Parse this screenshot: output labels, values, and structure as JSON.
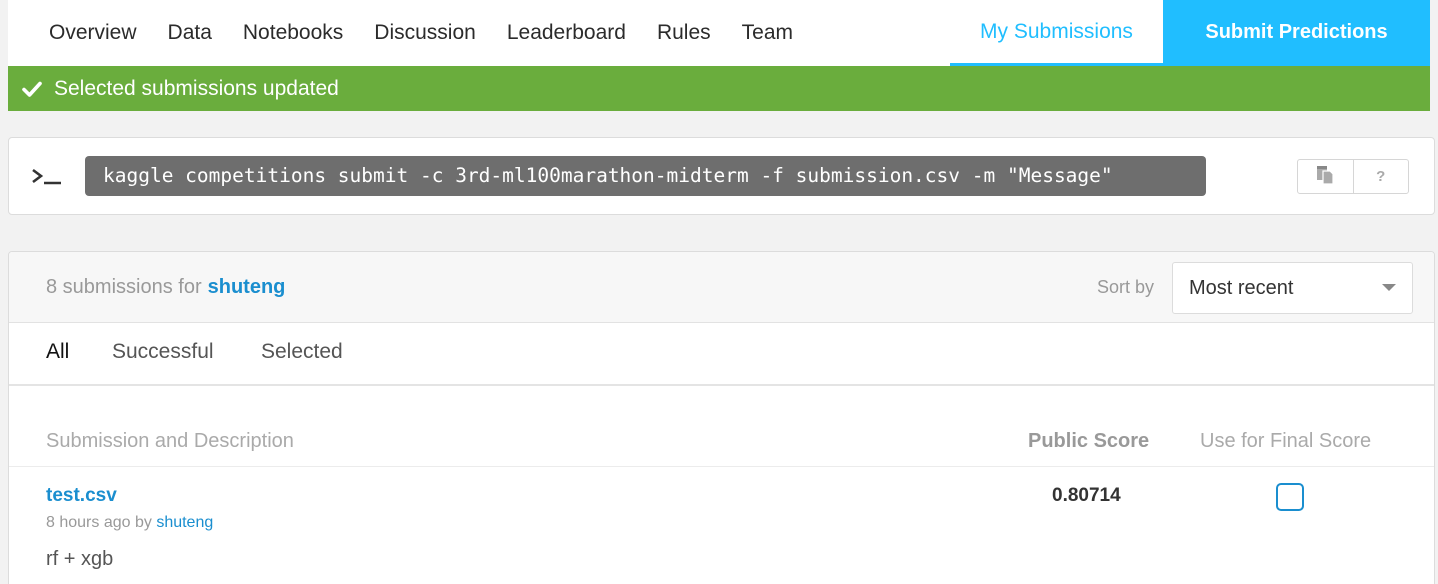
{
  "nav": {
    "tabs": [
      "Overview",
      "Data",
      "Notebooks",
      "Discussion",
      "Leaderboard",
      "Rules",
      "Team"
    ],
    "my_submissions": "My Submissions",
    "submit_predictions": "Submit Predictions"
  },
  "banner": {
    "message": "Selected submissions updated",
    "icon": "check-icon",
    "color": "#6aad3d"
  },
  "api": {
    "prompt_icon": "terminal-prompt-icon",
    "command": "kaggle competitions submit -c 3rd-ml100marathon-midterm -f submission.csv -m \"Message\"",
    "copy_icon": "copy-icon",
    "help_label": "?"
  },
  "submissions": {
    "count_text": "8 submissions for",
    "user": "shuteng",
    "sort_label": "Sort by",
    "sort_value": "Most recent",
    "filters": [
      "All",
      "Successful",
      "Selected"
    ],
    "active_filter": "All",
    "columns": {
      "description": "Submission and Description",
      "public_score": "Public Score",
      "final_score": "Use for Final Score"
    },
    "rows": [
      {
        "file": "test.csv",
        "time": "8 hours ago by",
        "user": "shuteng",
        "description": "rf + xgb",
        "public_score": "0.80714",
        "selected": false
      }
    ]
  },
  "colors": {
    "accent": "#20beff",
    "link": "#1a8ecf",
    "success": "#6aad3d"
  }
}
